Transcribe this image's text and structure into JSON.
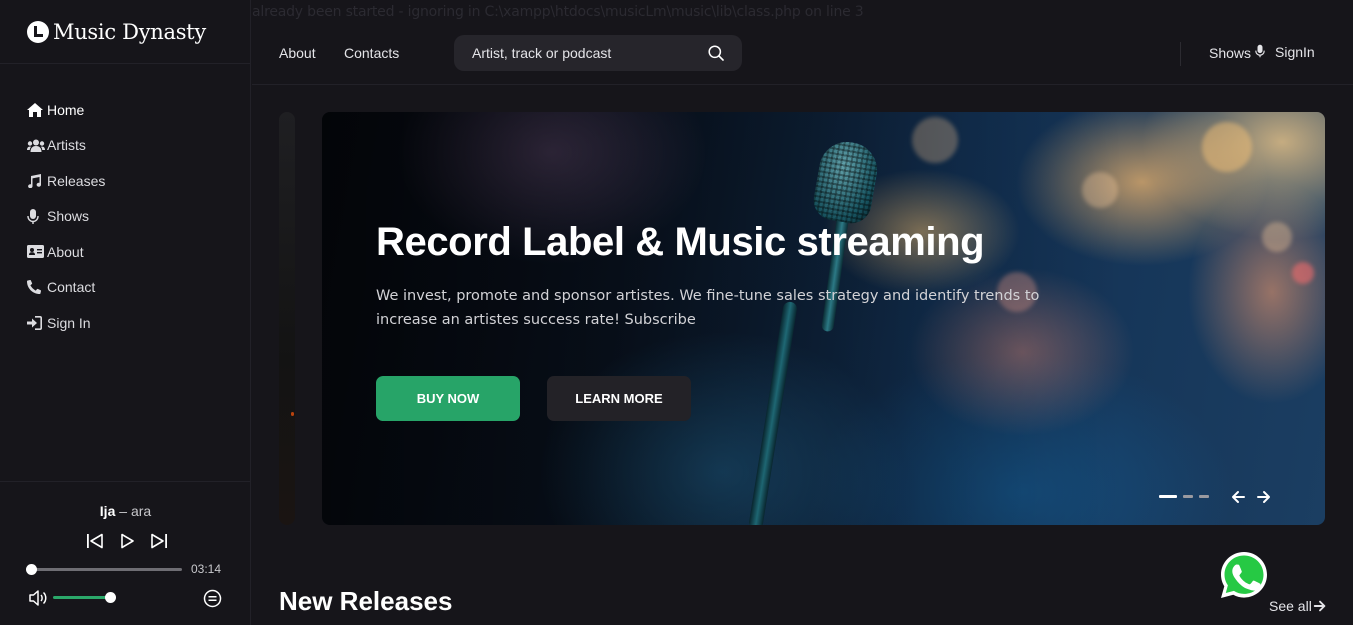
{
  "warning": {
    "text": "already been started - ignoring in C:\\xampp\\htdocs\\musicLm\\music\\lib\\class.php on line 3"
  },
  "brand": {
    "name": "Music Dynasty"
  },
  "sidebar": {
    "items": [
      {
        "label": "Home",
        "icon": "home-icon",
        "active": true
      },
      {
        "label": "Artists",
        "icon": "users-icon"
      },
      {
        "label": "Releases",
        "icon": "music-note-icon"
      },
      {
        "label": "Shows",
        "icon": "microphone-icon"
      },
      {
        "label": "About",
        "icon": "id-card-icon"
      },
      {
        "label": "Contact",
        "icon": "phone-icon"
      },
      {
        "label": "Sign In",
        "icon": "sign-in-icon"
      }
    ]
  },
  "player": {
    "track_title": "Ija",
    "track_separator": " – ",
    "track_artist": "ara",
    "duration": "03:14",
    "progress": 0.0,
    "volume": 1.0
  },
  "header": {
    "links": [
      "About",
      "Contacts"
    ],
    "search_placeholder": "Artist, track or podcast",
    "shows_label": "Shows",
    "signin_label": "SignIn"
  },
  "hero": {
    "title": "Record Label & Music streaming",
    "text": "We invest, promote and sponsor artistes. We fine-tune sales strategy and identify trends to increase an artistes success rate! Subscribe",
    "buy_label": "BUY NOW",
    "learn_label": "LEARN MORE",
    "slide_count": 3,
    "active_slide": 1
  },
  "section": {
    "title": "New Releases",
    "see_all": "See all"
  },
  "colors": {
    "background": "#16151a",
    "accent": "#27a468",
    "surface": "#232227"
  }
}
